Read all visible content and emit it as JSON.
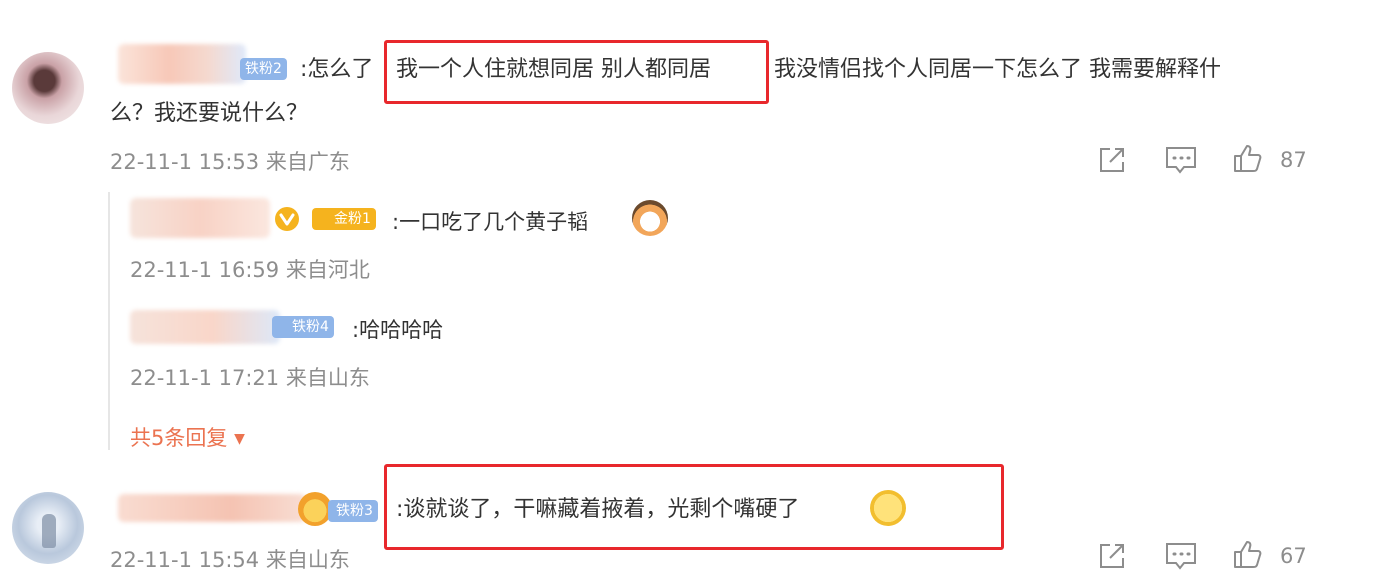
{
  "comments": [
    {
      "fan_badge": "铁粉2",
      "prefix": ":怎么了",
      "highlight": "我一个人住就想同居 别人都同居",
      "rest_line1": "我没情侣找个人同居一下怎么了 我需要解释什",
      "line2": "么？我还要说什么？",
      "timestamp": "22-11-1 15:53 来自广东",
      "like_count": "87",
      "replies": [
        {
          "fan_badge": "金粉1",
          "text": ":一口吃了几个黄子韬",
          "timestamp": "22-11-1 16:59 来自河北"
        },
        {
          "fan_badge": "铁粉4",
          "text": ":哈哈哈哈",
          "timestamp": "22-11-1 17:21 来自山东"
        }
      ],
      "more_replies": "共5条回复"
    },
    {
      "fan_badge": "铁粉3",
      "text": ":谈就谈了，干嘛藏着掖着，光剩个嘴硬了",
      "timestamp": "22-11-1 15:54 来自山东",
      "like_count": "67"
    }
  ],
  "icons": {
    "share": "share-icon",
    "comment": "comment-icon",
    "like": "thumbs-up-icon",
    "verified": "verified-v-icon",
    "expand": "caret-down-icon"
  },
  "colors": {
    "highlight_border": "#e8282c",
    "more_link": "#eb7350",
    "meta_text": "#8d8d8d",
    "gold_badge": "#f5b31e",
    "blue_badge": "#8fb5e9"
  }
}
